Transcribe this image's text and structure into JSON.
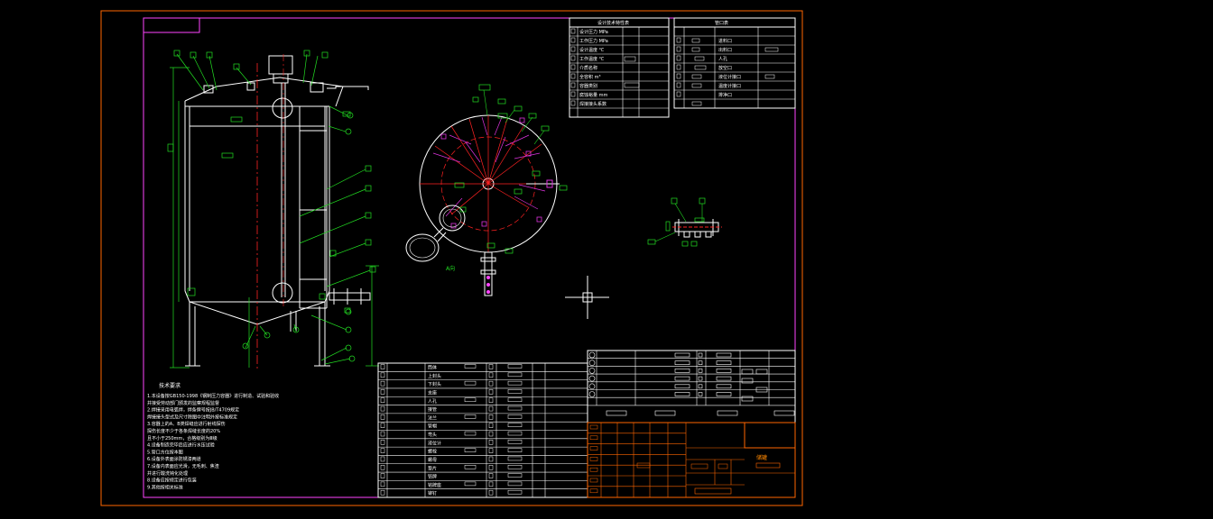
{
  "drawing": {
    "view_label": "A向",
    "title_block_name": "储罐",
    "notes_header": "技术要求",
    "notes": [
      "1.本设备按GB150-1998《钢制压力容器》进行制造、试验和验收",
      "  并接受劳动部门颁发的监察规程监督",
      "2.焊接采用电弧焊，焊条牌号按JB/T4709规定",
      "  焊接接头型式及尺寸除图中注明外按标准规定",
      "3.容器上的A、B类焊缝应进行射线探伤",
      "  探伤长度不少于各条焊缝长度的20%",
      "  且不小于250mm，合格级别为Ⅲ级",
      "4.设备制造完毕后应进行水压试验",
      "5.管口方位按本图",
      "6.设备外表面涂防锈漆两道",
      "7.设备内表面应光滑，无毛刺、焦渣",
      "  并进行酸洗钝化处理",
      "8.设备应按规定进行包装",
      "9.其他按相关标准"
    ],
    "spec_table_title": "设计技术特性表",
    "spec_rows": [
      "设计压力 MPa",
      "工作压力 MPa",
      "设计温度 ℃",
      "工作温度 ℃",
      "介质名称",
      "全容积 m³",
      "容器类别",
      "腐蚀裕量 mm",
      "焊接接头系数"
    ],
    "nozzle_table_title": "管口表",
    "nozzle_rows": [
      "进料口",
      "出料口",
      "人孔",
      "放空口",
      "液位计接口",
      "温度计接口",
      "排净口"
    ],
    "parts_rows": [
      "筒体",
      "上封头",
      "下封头",
      "支座",
      "人孔",
      "接管",
      "法兰",
      "管帽",
      "弯头",
      "液位计",
      "螺栓",
      "螺母",
      "垫片",
      "铭牌",
      "铭牌座",
      "铆钉"
    ]
  },
  "colors": {
    "border": "#ff44ff",
    "frame": "#ff6600",
    "line": "#ffffff",
    "center": "#ff2222",
    "label": "#22dd22",
    "hatch": "#dd33dd"
  },
  "icons": [
    "crosshair-cursor-icon"
  ]
}
